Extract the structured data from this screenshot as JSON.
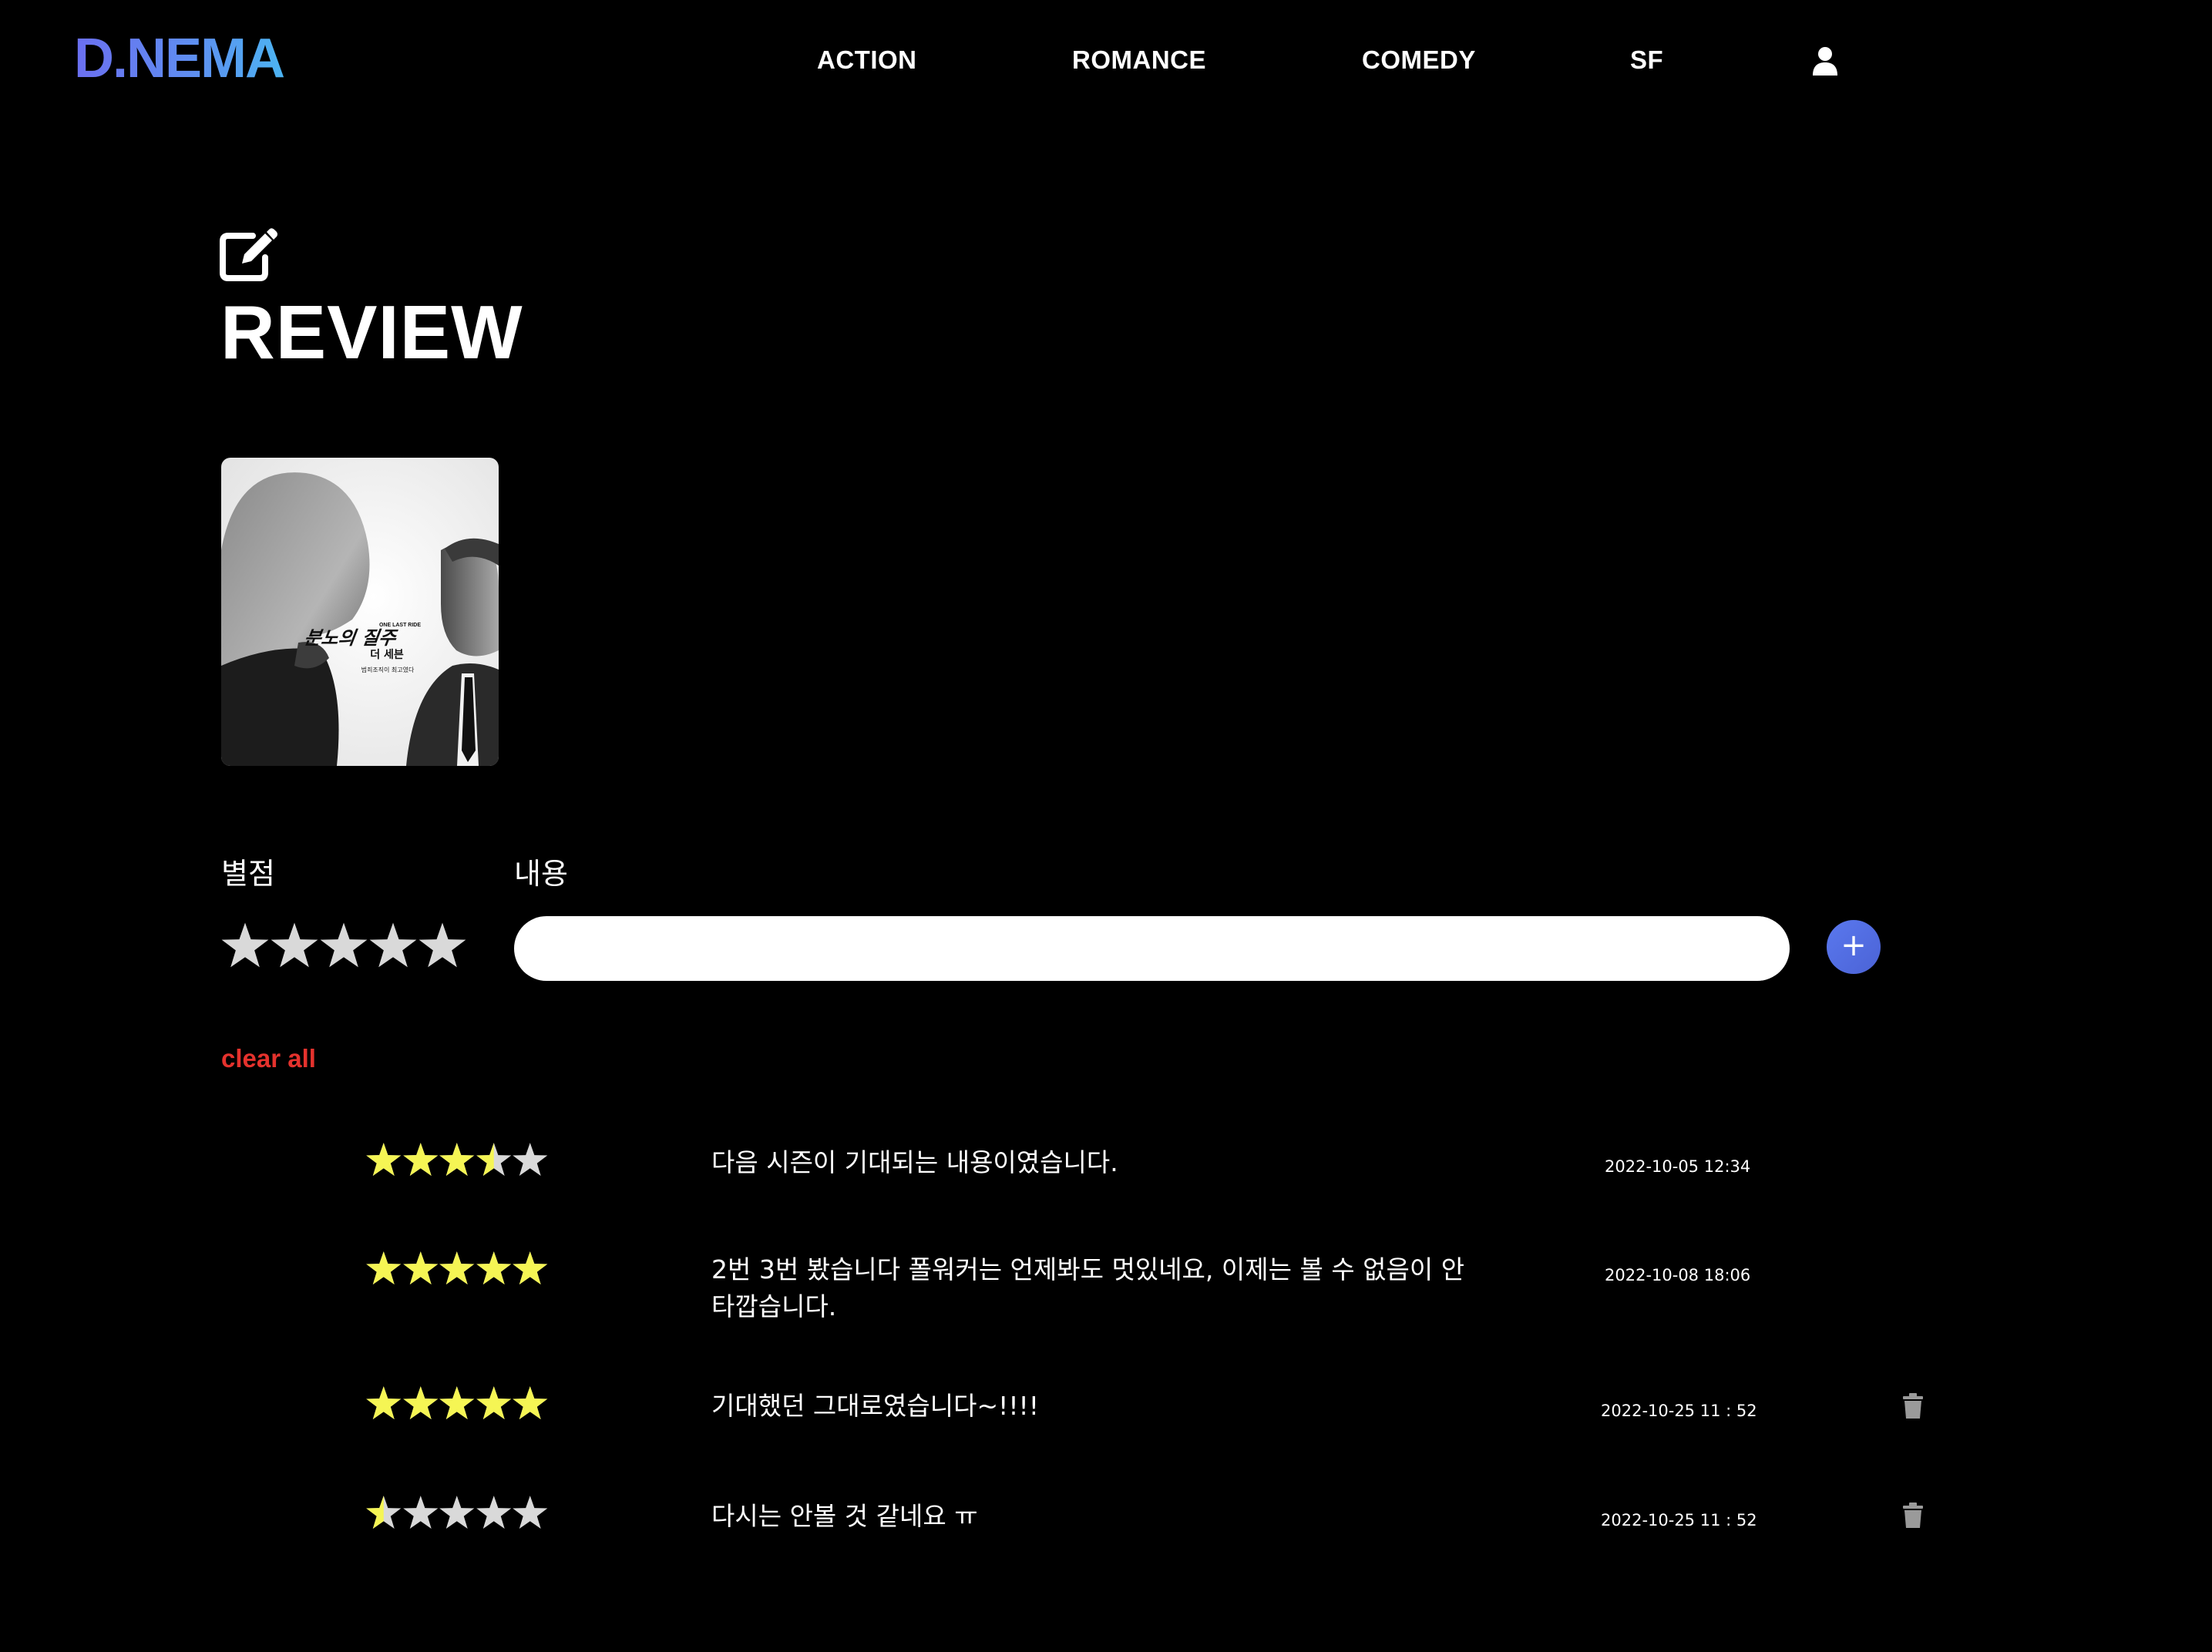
{
  "header": {
    "logo": "D.NEMA",
    "nav": [
      "ACTION",
      "ROMANCE",
      "COMEDY",
      "SF"
    ],
    "user_icon": "user-icon"
  },
  "page": {
    "title": "REVIEW",
    "title_icon": "edit-icon"
  },
  "poster": {
    "tagline": "ONE LAST RIDE",
    "title_ko": "분노의 질주",
    "subtitle_ko": "더 세븐",
    "caption_ko": "범죄조직이 최고였다"
  },
  "form": {
    "rating_label": "별점",
    "content_label": "내용",
    "rating": 0,
    "content_value": "",
    "add_icon": "plus-icon",
    "clear_label": "clear all"
  },
  "reviews": [
    {
      "rating": 3.5,
      "text": "다음 시즌이 기대되는 내용이였습니다.",
      "date": "2022-10-05 12:34",
      "deletable": false
    },
    {
      "rating": 5,
      "text": "2번 3번 봤습니다 폴워커는 언제봐도 멋있네요, 이제는 볼 수 없음이 안타깝습니다.",
      "date": "2022-10-08 18:06",
      "deletable": false
    },
    {
      "rating": 5,
      "text": "기대했던 그대로였습니다~!!!!",
      "date": "2022-10-25 11 : 52",
      "deletable": true
    },
    {
      "rating": 0.5,
      "text": "다시는 안볼 것 같네요 ㅠ",
      "date": "2022-10-25 11 : 52",
      "deletable": true
    }
  ],
  "colors": {
    "background": "#000000",
    "star_filled": "#f5f554",
    "star_empty": "#d9d9d9",
    "accent": "#5a78ee",
    "danger": "#e5322d",
    "trash": "#9a9a9a"
  }
}
